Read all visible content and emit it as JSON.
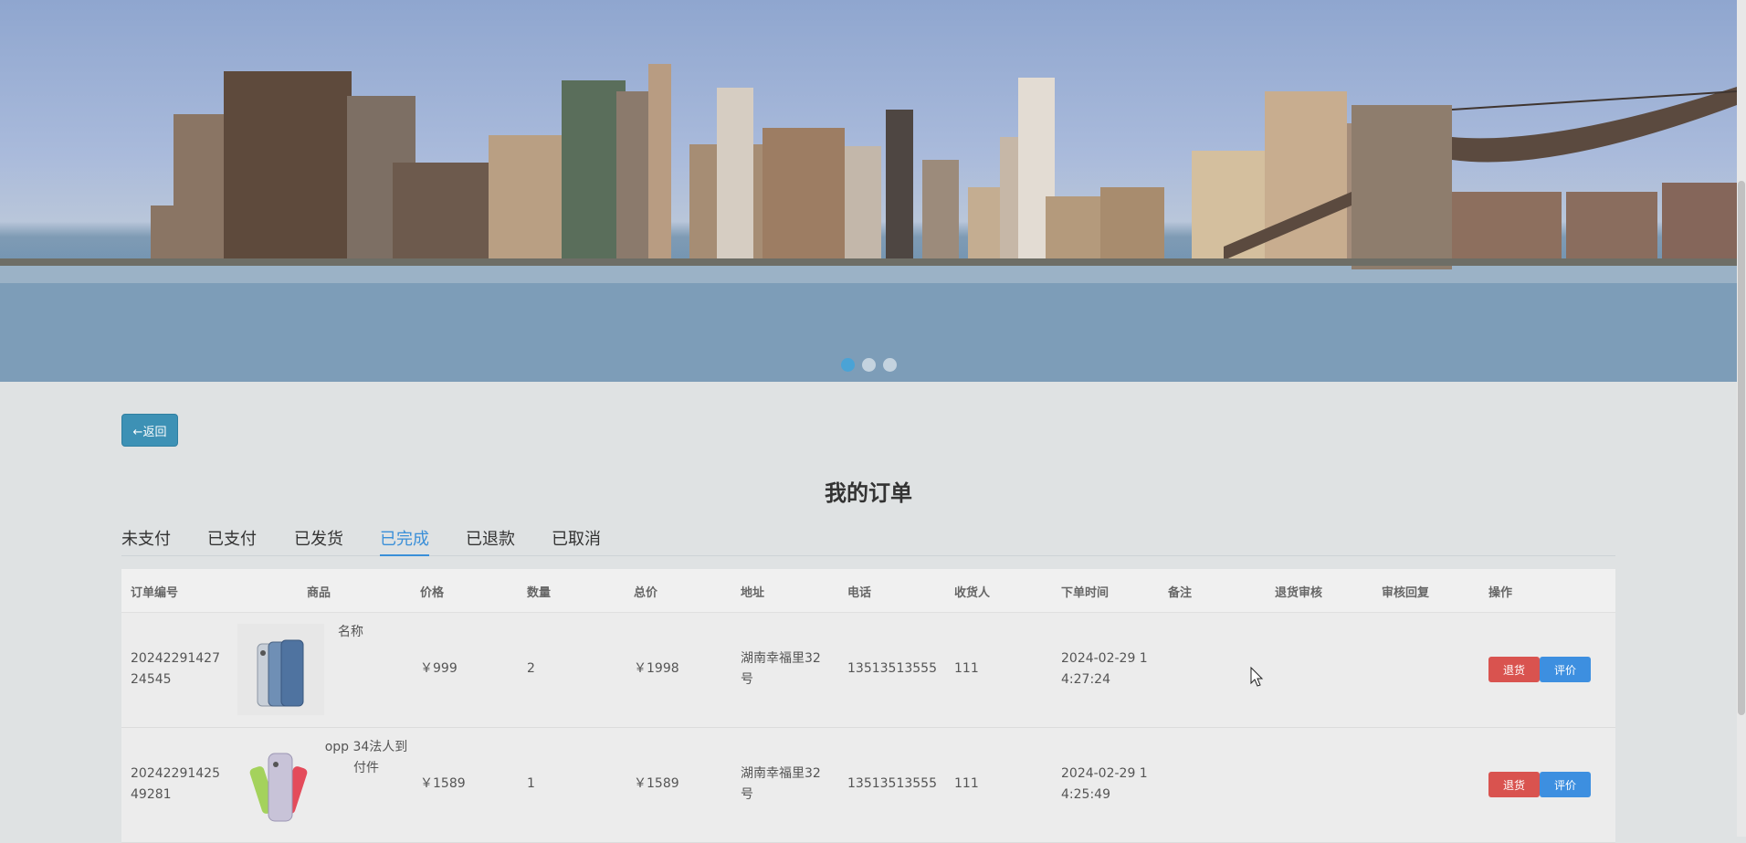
{
  "banner": {
    "active_slide": 1,
    "slide_count": 3
  },
  "back_button": {
    "label": "←返回"
  },
  "page_title": "我的订单",
  "tabs": [
    {
      "label": "未支付",
      "active": false
    },
    {
      "label": "已支付",
      "active": false
    },
    {
      "label": "已发货",
      "active": false
    },
    {
      "label": "已完成",
      "active": true
    },
    {
      "label": "已退款",
      "active": false
    },
    {
      "label": "已取消",
      "active": false
    }
  ],
  "table": {
    "headers": [
      "订单编号",
      "商品",
      "价格",
      "数量",
      "总价",
      "地址",
      "电话",
      "收货人",
      "下单时间",
      "备注",
      "退货审核",
      "审核回复",
      "操作"
    ],
    "rows": [
      {
        "order_no_1": "20242291427",
        "order_no_2": "24545",
        "product_name": "名称",
        "price": "￥999",
        "quantity": "2",
        "total": "￥1998",
        "address_1": "湖南幸福里32",
        "address_2": "号",
        "phone": "13513513555",
        "receiver": "111",
        "time_1": "2024-02-29 1",
        "time_2": "4:27:24",
        "return_label": "退货",
        "review_label": "评价"
      },
      {
        "order_no_1": "20242291425",
        "order_no_2": "49281",
        "product_name_1": "opp 34法人到",
        "product_name_2": "付件",
        "price": "￥1589",
        "quantity": "1",
        "total": "￥1589",
        "address_1": "湖南幸福里32",
        "address_2": "号",
        "phone": "13513513555",
        "receiver": "111",
        "time_1": "2024-02-29 1",
        "time_2": "4:25:49",
        "return_label": "退货",
        "review_label": "评价"
      }
    ]
  },
  "colors": {
    "accent": "#3a8fd8",
    "danger": "#d9534f",
    "back_button": "#3d91b5"
  }
}
